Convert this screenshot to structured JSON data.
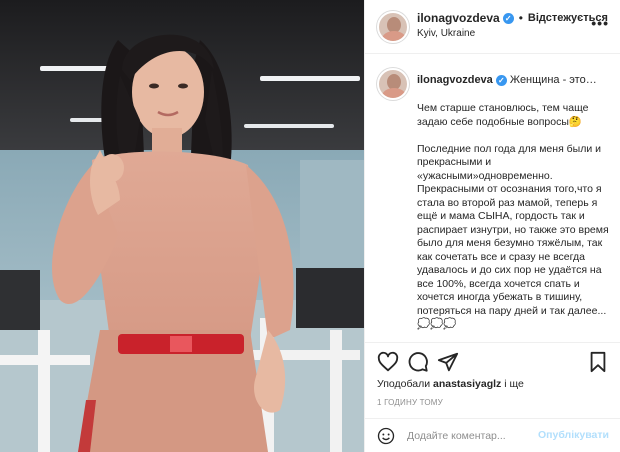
{
  "post": {
    "username": "ilonagvozdeva",
    "follow_state": "Відстежується",
    "location": "Kyiv, Ukraine",
    "more_icon": "more-dots-icon"
  },
  "caption": {
    "username": "ilonagvozdeva",
    "title": "Женщина - это…",
    "text": "Чем старше становлюсь, тем чаще задаю себе подобные вопросы🤔\n\nПоследние пол года для меня были и прекрасными и «ужасными»одновременно. Прекрасными от осознания того,что я стала во второй раз мамой, теперь я ещё и мама СЫНА, гордость так и распирает изнутри, но также это время было для меня безумно тяжёлым, так как сочетать все и сразу не всегда удавалось и до сих пор не удаётся на все 100%, всегда хочется спать и хочется иногда убежать в тишину, потеряться на пару дней и так далее...💭💭💭"
  },
  "actions": {
    "like_icon": "heart-icon",
    "comment_icon": "comment-icon",
    "share_icon": "share-icon",
    "save_icon": "bookmark-icon"
  },
  "likes": {
    "prefix": "Уподобали",
    "user": "anastasiyaglz",
    "suffix": "і ще"
  },
  "timestamp": "1 ГОДИНУ ТОМУ",
  "comment": {
    "placeholder": "Додайте коментар...",
    "publish_label": "Опублікувати",
    "emoji_icon": "smiley-icon"
  },
  "colors": {
    "accent": "#3897f0",
    "publish_disabled": "#b2dffc",
    "muted": "#8e8e8e",
    "border": "#efefef"
  }
}
